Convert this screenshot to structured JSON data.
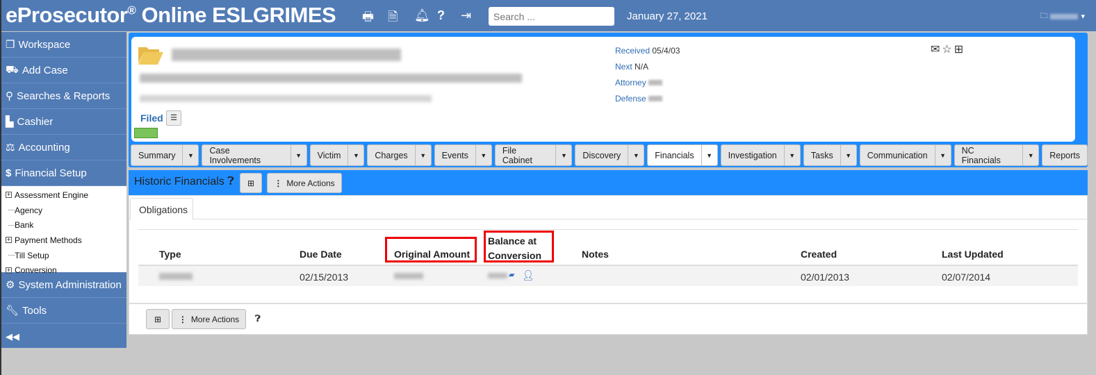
{
  "header": {
    "title": "eProsecutor",
    "reg": "®",
    "title_rest": " Online ESLGRIMES",
    "search_placeholder": "Search ...",
    "date": "January 27, 2021",
    "icons": [
      "print-icon",
      "document-icon",
      "bell-icon",
      "help-icon",
      "logout-icon"
    ]
  },
  "sidebar": {
    "items": [
      {
        "label": "Workspace",
        "icon": "workspace-icon"
      },
      {
        "label": "Add Case",
        "icon": "add-case-icon"
      },
      {
        "label": "Searches & Reports",
        "icon": "search-icon"
      },
      {
        "label": "Cashier",
        "icon": "cashier-icon"
      },
      {
        "label": "Accounting",
        "icon": "accounting-icon"
      },
      {
        "label": "Financial Setup",
        "icon": "dollar-icon"
      }
    ],
    "tree": [
      {
        "label": "Assessment Engine",
        "expandable": true
      },
      {
        "label": "Agency",
        "expandable": false
      },
      {
        "label": "Bank",
        "expandable": false
      },
      {
        "label": "Payment Methods",
        "expandable": true
      },
      {
        "label": "Till Setup",
        "expandable": false
      },
      {
        "label": "Conversion",
        "expandable": true
      }
    ],
    "bottom": [
      {
        "label": "System Administration",
        "icon": "gears-icon"
      },
      {
        "label": "Tools",
        "icon": "wrench-icon"
      }
    ]
  },
  "case": {
    "received_label": "Received",
    "received": "05/4/03",
    "next_label": "Next",
    "next": "N/A",
    "attorney_label": "Attorney",
    "defense_label": "Defense",
    "status": "Filed"
  },
  "tabs": [
    "Summary",
    "Case Involvements",
    "Victim",
    "Charges",
    "Events",
    "File Cabinet",
    "Discovery",
    "Financials",
    "Investigation",
    "Tasks",
    "Communication",
    "NC Financials",
    "Reports"
  ],
  "active_tab": "Financials",
  "section": {
    "title": "Historic Financials",
    "more_actions": "More Actions",
    "subtab": "Obligations"
  },
  "table": {
    "columns": [
      "Type",
      "Due Date",
      "Original Amount",
      "Balance at Conversion",
      "Notes",
      "Created",
      "Last Updated"
    ],
    "balance_line1": "Balance at",
    "balance_line2": "Conversion",
    "rows": [
      {
        "due_date": "02/15/2013",
        "created": "02/01/2013",
        "last_updated": "02/07/2014"
      }
    ]
  },
  "colors": {
    "header": "#517bb5",
    "accent": "#1e8cff",
    "highlight": "#e00000"
  }
}
